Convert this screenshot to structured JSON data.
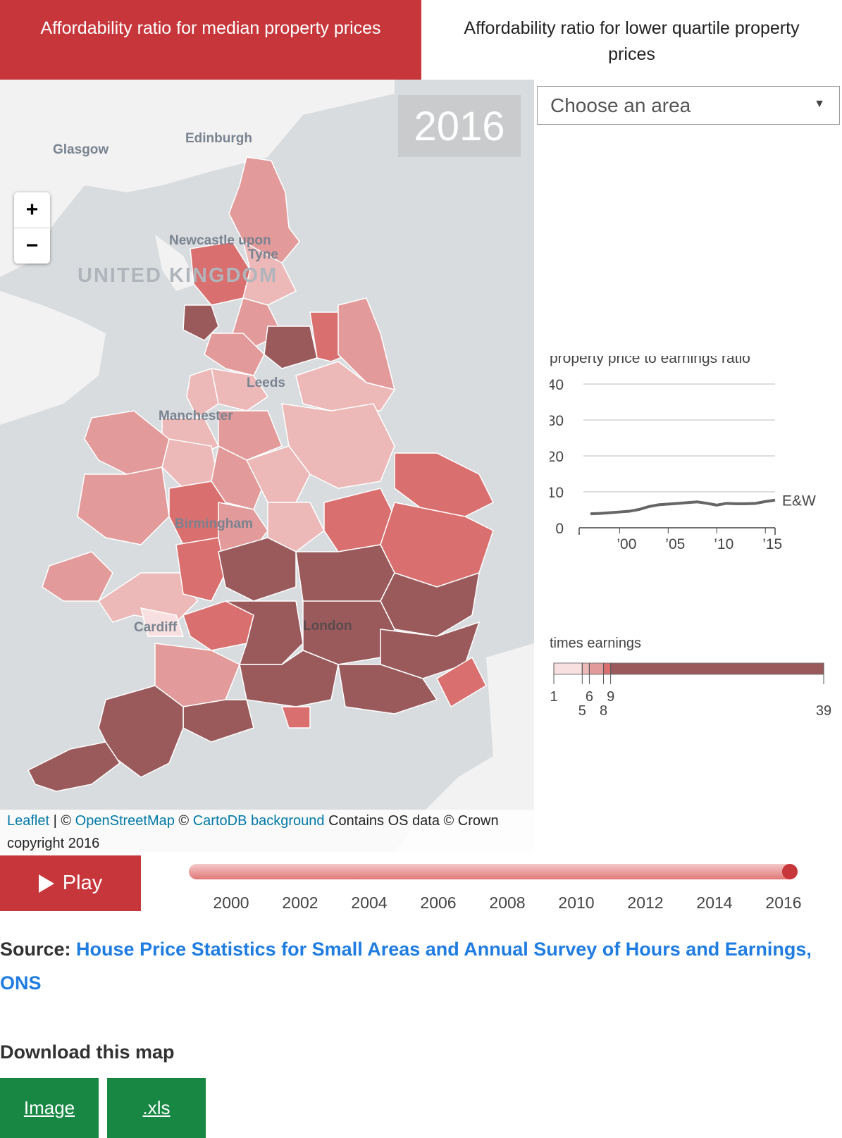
{
  "tabs": {
    "active_label": "Affordability ratio for median property prices",
    "inactive_label": "Affordability ratio for lower quartile property prices"
  },
  "map": {
    "year": "2016",
    "zoom_in": "+",
    "zoom_out": "−",
    "labels": {
      "edinburgh": "Edinburgh",
      "glasgow": "Glasgow",
      "newcastle_1": "Newcastle upon",
      "newcastle_2": "Tyne",
      "uk": "UNITED KINGDOM",
      "leeds": "Leeds",
      "manchester": "Manchester",
      "birmingham": "Birmingham",
      "cardiff": "Cardiff",
      "london": "London"
    },
    "attribution": {
      "leaflet": "Leaflet",
      "sep": " | © ",
      "osm": "OpenStreetMap",
      "sep2": " © ",
      "carto": "CartoDB background",
      "rest": " Contains OS data © Crown copyright 2016"
    },
    "colors": {
      "sea": "#d9dcdf",
      "land": "#f2f2f2",
      "lightest": "#f8e0e0",
      "light": "#ecb8b8",
      "mid": "#e39a9a",
      "midhigh": "#d96f6f",
      "highest": "#9a5a5c"
    }
  },
  "area_select": {
    "placeholder": "Choose an area",
    "caret": "▼"
  },
  "chart_data": {
    "type": "line",
    "title": "property price to earnings ratio",
    "series": [
      {
        "name": "E&W",
        "x": [
          1997,
          1998,
          1999,
          2000,
          2001,
          2002,
          2003,
          2004,
          2005,
          2006,
          2007,
          2008,
          2009,
          2010,
          2011,
          2012,
          2013,
          2014,
          2015,
          2016
        ],
        "values": [
          3.9,
          4.0,
          4.2,
          4.4,
          4.6,
          5.1,
          5.9,
          6.4,
          6.6,
          6.8,
          7.0,
          7.2,
          6.8,
          6.3,
          6.8,
          6.7,
          6.7,
          6.8,
          7.3,
          7.7
        ]
      }
    ],
    "yticks": [
      "40",
      "30",
      "20",
      "10",
      "0"
    ],
    "xticks": [
      "’00",
      "’05",
      "’10",
      "’15"
    ],
    "ylim": [
      0,
      40
    ],
    "xlim": [
      1997,
      2016
    ],
    "grid": true
  },
  "legend": {
    "title": "times earnings",
    "breaks": [
      "1",
      "5",
      "6",
      "8",
      "9",
      "39"
    ],
    "colors": [
      "#f8e0e0",
      "#ecb8b8",
      "#e39a9a",
      "#d96f6f",
      "#9a5a5c"
    ]
  },
  "player": {
    "play_label": "Play",
    "years": [
      "2000",
      "2002",
      "2004",
      "2006",
      "2008",
      "2010",
      "2012",
      "2014",
      "2016"
    ],
    "current": "2016",
    "progress": 1.0
  },
  "source": {
    "label": "Source:",
    "link": "House Price Statistics for Small Areas and Annual Survey of Hours and Earnings, ONS"
  },
  "download": {
    "title": "Download this map",
    "image": "Image",
    "xls": ".xls"
  }
}
